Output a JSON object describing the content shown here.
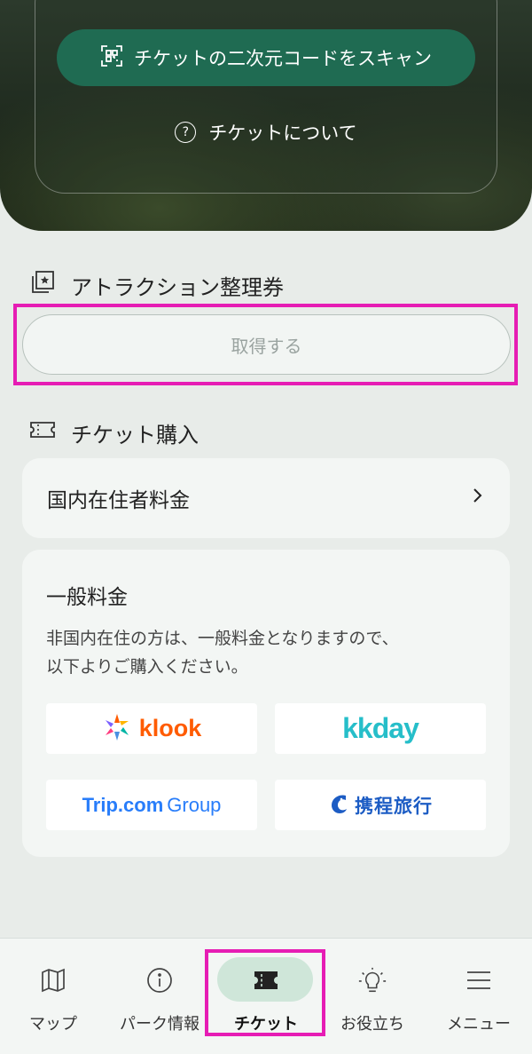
{
  "hero": {
    "scan_button_label": "チケットの二次元コードをスキャン",
    "about_link_label": "チケットについて"
  },
  "attraction": {
    "heading": "アトラクション整理券",
    "get_button_label": "取得する"
  },
  "ticket_purchase": {
    "heading": "チケット購入",
    "resident_price_label": "国内在住者料金",
    "general": {
      "title": "一般料金",
      "description_line1": "非国内在住の方は、一般料金となりますので、",
      "description_line2": "以下よりご購入ください。",
      "partners": {
        "klook": "klook",
        "kkday": "kkday",
        "trip": "Trip.com",
        "trip_group": "Group",
        "ctrip": "携程旅行"
      }
    }
  },
  "bottom_nav": {
    "map": "マップ",
    "park_info": "パーク情報",
    "ticket": "チケット",
    "help": "お役立ち",
    "menu": "メニュー"
  },
  "colors": {
    "accent_green": "#1f6b52",
    "highlight_magenta": "#e61db4",
    "active_pill": "#cfe6d9"
  }
}
